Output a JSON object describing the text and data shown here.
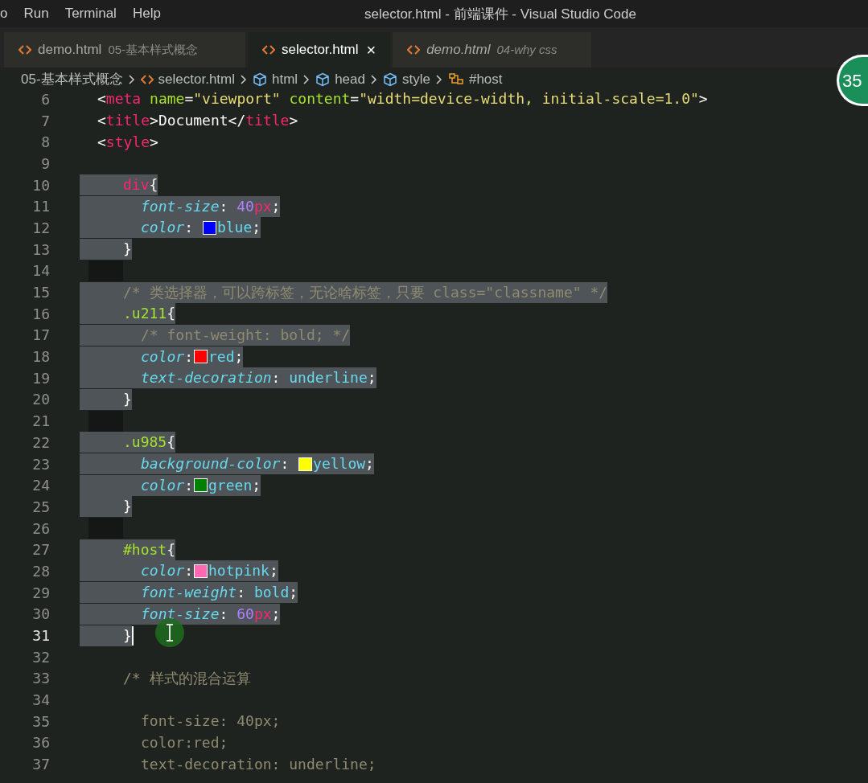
{
  "menu": [
    {
      "label": "o"
    },
    {
      "label": "Run"
    },
    {
      "label": "Terminal"
    },
    {
      "label": "Help"
    }
  ],
  "window": {
    "title": "selector.html - 前端课件 - Visual Studio Code"
  },
  "tabs": [
    {
      "label": "demo.html",
      "description": "05-基本样式概念",
      "selected": false,
      "preview": false
    },
    {
      "label": "selector.html",
      "selected": true,
      "preview": false,
      "close": "×"
    },
    {
      "label": "demo.html",
      "description": "04-why css",
      "selected": false,
      "preview": true
    }
  ],
  "breadcrumbs": [
    {
      "label": "05-基本样式概念",
      "kind": "folder"
    },
    {
      "label": "selector.html",
      "kind": "file"
    },
    {
      "label": "html",
      "kind": "element"
    },
    {
      "label": "head",
      "kind": "element"
    },
    {
      "label": "style",
      "kind": "element"
    },
    {
      "label": "#host",
      "kind": "selector"
    }
  ],
  "overlay_badge": {
    "text": "35"
  },
  "lines": [
    {
      "number": "6",
      "kind": "markup",
      "selected": false,
      "current": false,
      "text": "<meta name=\"viewport\" content=\"width=device-width, initial-scale=1.0\">"
    },
    {
      "number": "7",
      "kind": "markup",
      "selected": false,
      "current": false,
      "text": "<title>Document</title>"
    },
    {
      "number": "8",
      "kind": "markup",
      "selected": false,
      "current": false,
      "text": "<style>"
    },
    {
      "number": "9",
      "kind": "blank",
      "selected": false,
      "current": false
    },
    {
      "number": "10",
      "kind": "rule",
      "selected": true,
      "current": false,
      "text": "div{"
    },
    {
      "number": "11",
      "kind": "declaration",
      "selected": true,
      "current": false,
      "text": "font-size: 40px;"
    },
    {
      "number": "12",
      "kind": "declaration",
      "selected": true,
      "current": false,
      "text": "color: ",
      "color": "#0000ff",
      "value": "blue;"
    },
    {
      "number": "13",
      "kind": "rule",
      "selected": true,
      "current": false,
      "text": "}"
    },
    {
      "number": "14",
      "kind": "blank",
      "selected": true,
      "current": false
    },
    {
      "number": "15",
      "kind": "rule-comment",
      "selected": true,
      "current": false,
      "text": "/* 类选择器，可以跨标签，无论啥标签，只要 class=\"classname\" */"
    },
    {
      "number": "16",
      "kind": "rule",
      "selected": true,
      "current": false,
      "text": ".u211{"
    },
    {
      "number": "17",
      "kind": "declaration-comment",
      "selected": true,
      "current": false,
      "text": "/* font-weight: bold; */"
    },
    {
      "number": "18",
      "kind": "declaration",
      "selected": true,
      "current": false,
      "text": "color:",
      "color": "#ff0000",
      "value": "red;"
    },
    {
      "number": "19",
      "kind": "declaration",
      "selected": true,
      "current": false,
      "text": "text-decoration: underline;"
    },
    {
      "number": "20",
      "kind": "rule",
      "selected": true,
      "current": false,
      "text": "}"
    },
    {
      "number": "21",
      "kind": "blank",
      "selected": true,
      "current": false
    },
    {
      "number": "22",
      "kind": "rule",
      "selected": true,
      "current": false,
      "text": ".u985{"
    },
    {
      "number": "23",
      "kind": "declaration",
      "selected": true,
      "current": false,
      "text": "background-color: ",
      "color": "#ffff00",
      "value": "yellow;"
    },
    {
      "number": "24",
      "kind": "declaration",
      "selected": true,
      "current": false,
      "text": "color:",
      "color": "#008000",
      "value": "green;"
    },
    {
      "number": "25",
      "kind": "rule",
      "selected": true,
      "current": false,
      "text": "}"
    },
    {
      "number": "26",
      "kind": "blank",
      "selected": true,
      "current": false
    },
    {
      "number": "27",
      "kind": "rule",
      "selected": true,
      "current": false,
      "text": "#host{"
    },
    {
      "number": "28",
      "kind": "declaration",
      "selected": true,
      "current": false,
      "text": "color:",
      "color": "#ff69b4",
      "value": "hotpink;"
    },
    {
      "number": "29",
      "kind": "declaration",
      "selected": true,
      "current": false,
      "text": "font-weight: bold;"
    },
    {
      "number": "30",
      "kind": "declaration",
      "selected": true,
      "current": false,
      "text": "font-size: 60px;"
    },
    {
      "number": "31",
      "kind": "rule",
      "selected": true,
      "current": true,
      "text": "}"
    },
    {
      "number": "32",
      "kind": "blank",
      "selected": false,
      "current": false
    },
    {
      "number": "33",
      "kind": "rule-comment",
      "selected": false,
      "current": false,
      "text": "/* 样式的混合运算"
    },
    {
      "number": "34",
      "kind": "blank",
      "selected": false,
      "current": false
    },
    {
      "number": "35",
      "kind": "declaration-comment",
      "selected": false,
      "current": false,
      "text": "font-size: 40px;"
    },
    {
      "number": "36",
      "kind": "declaration-comment",
      "selected": false,
      "current": false,
      "text": "color:red;"
    },
    {
      "number": "37",
      "kind": "declaration-comment",
      "selected": false,
      "current": false,
      "text": "text-decoration: underline;"
    }
  ]
}
